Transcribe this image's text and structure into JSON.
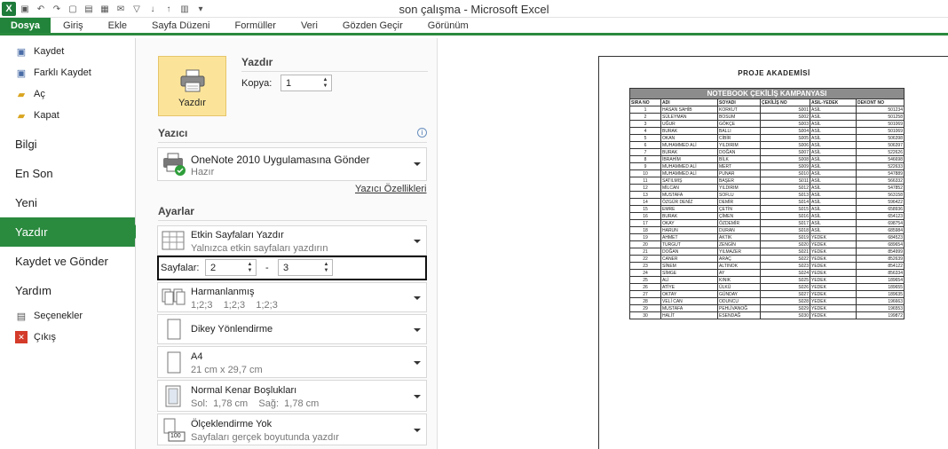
{
  "window": {
    "title": "son çalışma  -  Microsoft Excel"
  },
  "ribbon": {
    "tabs": [
      {
        "label": "Dosya"
      },
      {
        "label": "Giriş"
      },
      {
        "label": "Ekle"
      },
      {
        "label": "Sayfa Düzeni"
      },
      {
        "label": "Formüller"
      },
      {
        "label": "Veri"
      },
      {
        "label": "Gözden Geçir"
      },
      {
        "label": "Görünüm"
      }
    ]
  },
  "backstage": {
    "commands": [
      {
        "label": "Kaydet",
        "icon": "save-icon"
      },
      {
        "label": "Farklı Kaydet",
        "icon": "save-as-icon"
      },
      {
        "label": "Aç",
        "icon": "open-folder-icon"
      },
      {
        "label": "Kapat",
        "icon": "close-folder-icon"
      }
    ],
    "sections": [
      {
        "label": "Bilgi"
      },
      {
        "label": "En Son"
      },
      {
        "label": "Yeni"
      },
      {
        "label": "Yazdır"
      },
      {
        "label": "Kaydet ve Gönder"
      },
      {
        "label": "Yardım"
      }
    ],
    "bottom": [
      {
        "label": "Seçenekler",
        "icon": "options-icon"
      },
      {
        "label": "Çıkış",
        "icon": "exit-icon"
      }
    ]
  },
  "print": {
    "heading": "Yazdır",
    "button_label": "Yazdır",
    "copies_label": "Kopya:",
    "copies_value": "1",
    "printer_heading": "Yazıcı",
    "printer_name": "OneNote 2010 Uygulamasına Gönder",
    "printer_status": "Hazır",
    "printer_properties": "Yazıcı Özellikleri",
    "settings_heading": "Ayarlar",
    "print_what": {
      "title": "Etkin Sayfaları Yazdır",
      "subtitle": "Yalnızca etkin sayfaları yazdırın"
    },
    "pages_label": "Sayfalar:",
    "pages_from": "2",
    "pages_to": "3",
    "pages_dash": "-",
    "collate": {
      "title": "Harmanlanmış",
      "subtitle": "1;2;3    1;2;3    1;2;3"
    },
    "orientation": {
      "title": "Dikey Yönlendirme"
    },
    "paper": {
      "title": "A4",
      "subtitle": "21 cm x 29,7 cm"
    },
    "margins": {
      "title": "Normal Kenar Boşlukları",
      "subtitle": "Sol:  1,78 cm    Sağ:  1,78 cm"
    },
    "scaling": {
      "title": "Ölçeklendirme Yok",
      "subtitle": "Sayfaları gerçek boyutunda yazdır",
      "badge": "100"
    }
  },
  "preview": {
    "title": "PROJE AKADEMİSİ",
    "banner": "NOTEBOOK ÇEKİLİŞ KAMPANYASI",
    "headers": [
      "SIRA NO",
      "ADI",
      "SOYADI",
      "ÇEKİLİŞ NO",
      "ASIL-YEDEK",
      "DEKONT NO"
    ],
    "rows": [
      [
        "1",
        "HASAN SAHİB",
        "KORKUT",
        "S001",
        "ASİL",
        "501234"
      ],
      [
        "2",
        "SÜLEYMAN",
        "BOSUM",
        "S002",
        "ASİL",
        "501258"
      ],
      [
        "3",
        "UĞUR",
        "GÖKÇE",
        "S003",
        "ASİL",
        "501069"
      ],
      [
        "4",
        "BURAK",
        "BALLI",
        "S004",
        "ASİL",
        "501069"
      ],
      [
        "5",
        "OKAN",
        "CİBİR",
        "S005",
        "ASİL",
        "506398"
      ],
      [
        "6",
        "MUHAMMED ALİ",
        "YILDIRIM",
        "S006",
        "ASİL",
        "506397"
      ],
      [
        "7",
        "BURAK",
        "DOĞAN",
        "S007",
        "ASİL",
        "522626"
      ],
      [
        "8",
        "İBRAHİM",
        "BİLK",
        "S008",
        "ASİL",
        "546698"
      ],
      [
        "9",
        "MUHAMMED ALİ",
        "MERT",
        "S009",
        "ASİL",
        "522633"
      ],
      [
        "10",
        "MUHAMMED ALİ",
        "PUNAR",
        "S010",
        "ASİL",
        "547889"
      ],
      [
        "11",
        "SATILMIŞ",
        "BAŞER",
        "S011",
        "ASİL",
        "566332"
      ],
      [
        "12",
        "MİLCAN",
        "YILDIRIM",
        "S012",
        "ASİL",
        "547852"
      ],
      [
        "13",
        "MUSTAFA",
        "SOFLU",
        "S013",
        "ASİL",
        "563158"
      ],
      [
        "14",
        "ÖZGÜR DENİZ",
        "DEMİR",
        "S014",
        "ASİL",
        "596422"
      ],
      [
        "15",
        "EMRE",
        "ÇETİN",
        "S015",
        "ASİL",
        "658936"
      ],
      [
        "16",
        "BURAK",
        "ÇİMEN",
        "S016",
        "ASİL",
        "654123"
      ],
      [
        "17",
        "OKAY",
        "ÖZDEMİR",
        "S017",
        "ASİL",
        "698754"
      ],
      [
        "18",
        "HARUN",
        "DURAN",
        "S018",
        "ASİL",
        "685984"
      ],
      [
        "19",
        "AHMET",
        "AKTIK",
        "S019",
        "YEDEK",
        "684523"
      ],
      [
        "20",
        "TURGUT",
        "ZENGİN",
        "S020",
        "YEDEK",
        "689654"
      ],
      [
        "21",
        "DOĞAN",
        "YILMAZER",
        "S021",
        "YEDEK",
        "854999"
      ],
      [
        "22",
        "CANER",
        "ARAÇ",
        "S022",
        "YEDEK",
        "852639"
      ],
      [
        "23",
        "SİNEM",
        "ALTINOK",
        "S023",
        "YEDEK",
        "854122"
      ],
      [
        "24",
        "SİMGE",
        "AY",
        "S024",
        "YEDEK",
        "856334"
      ],
      [
        "25",
        "ALİ",
        "KINIK",
        "S025",
        "YEDEK",
        "189654"
      ],
      [
        "26",
        "ATİYE",
        "ÜLKÜ",
        "S026",
        "YEDEK",
        "189655"
      ],
      [
        "27",
        "OKTAY",
        "GÜNDAY",
        "S027",
        "YEDEK",
        "189635"
      ],
      [
        "28",
        "VELİ CAN",
        "ODUNCU",
        "S028",
        "YEDEK",
        "196663"
      ],
      [
        "29",
        "MUSTAFA",
        "PEHLİVANOĞ",
        "S029",
        "YEDEK",
        "196553"
      ],
      [
        "30",
        "HALİT",
        "ESENDAĞ",
        "S030",
        "YEDEK",
        "199872"
      ]
    ]
  }
}
